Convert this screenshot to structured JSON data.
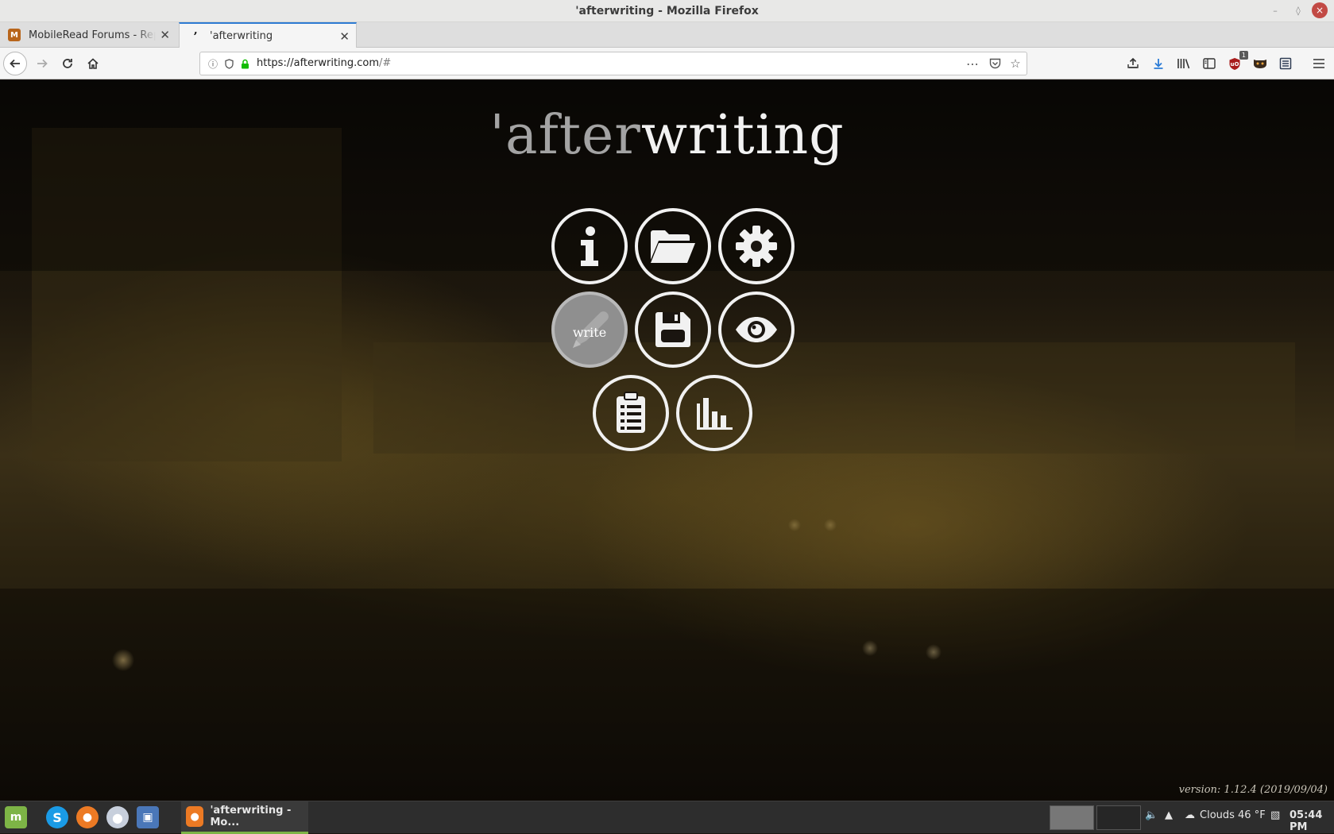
{
  "window": {
    "title": "'afterwriting - Mozilla Firefox"
  },
  "tabs": [
    {
      "label": "MobileRead Forums - Reply to",
      "favicon": "mobileread-favicon",
      "active": false
    },
    {
      "label": "'afterwriting",
      "favicon": "afterwriting-favicon",
      "active": true
    }
  ],
  "navbar": {
    "url_host": "https://afterwriting.com",
    "url_path": "/#"
  },
  "page": {
    "logo_prefix": "'after",
    "logo_suffix": "writing",
    "buttons": [
      {
        "name": "info",
        "icon": "info-icon"
      },
      {
        "name": "open",
        "icon": "folder-icon"
      },
      {
        "name": "settings",
        "icon": "gear-icon"
      },
      {
        "name": "write",
        "icon": "pen-icon",
        "label": "write",
        "active": true
      },
      {
        "name": "save",
        "icon": "floppy-icon"
      },
      {
        "name": "preview",
        "icon": "eye-icon"
      },
      {
        "name": "facts",
        "icon": "clipboard-icon"
      },
      {
        "name": "stats",
        "icon": "bar-chart-icon"
      }
    ],
    "version": "version: 1.12.4 (2019/09/04)"
  },
  "toolbar": {
    "ublock_badge": "1"
  },
  "taskbar": {
    "task_label": "'afterwriting - Mo...",
    "weather": "Clouds 46 °F",
    "clock": "05:44 PM"
  },
  "colors": {
    "tab_accent": "#2e7bd3",
    "lock_green": "#12bc00",
    "mint_green": "#7db446",
    "logo_after": "#a3a3a3",
    "logo_writing": "#f2f2f2"
  }
}
